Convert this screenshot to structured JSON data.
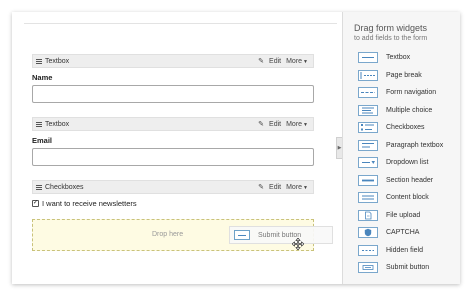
{
  "form": {
    "fields": [
      {
        "type": "Textbox",
        "label": "Name",
        "edit": "Edit",
        "more": "More"
      },
      {
        "type": "Textbox",
        "label": "Email",
        "edit": "Edit",
        "more": "More"
      },
      {
        "type": "Checkboxes",
        "edit": "Edit",
        "more": "More",
        "option": "I want to receive newsletters",
        "checked": true
      }
    ],
    "dropzone": {
      "label": "Drop here",
      "dragging": "Submit button"
    }
  },
  "panel": {
    "title": "Drag form widgets",
    "subtitle": "to add fields to the form",
    "widgets": [
      {
        "label": "Textbox",
        "icon": "textbox-icon"
      },
      {
        "label": "Page break",
        "icon": "page-break-icon"
      },
      {
        "label": "Form navigation",
        "icon": "form-navigation-icon"
      },
      {
        "label": "Multiple choice",
        "icon": "multiple-choice-icon"
      },
      {
        "label": "Checkboxes",
        "icon": "checkboxes-icon"
      },
      {
        "label": "Paragraph textbox",
        "icon": "paragraph-textbox-icon"
      },
      {
        "label": "Dropdown list",
        "icon": "dropdown-list-icon"
      },
      {
        "label": "Section header",
        "icon": "section-header-icon"
      },
      {
        "label": "Content block",
        "icon": "content-block-icon"
      },
      {
        "label": "File upload",
        "icon": "file-upload-icon"
      },
      {
        "label": "CAPTCHA",
        "icon": "captcha-icon"
      },
      {
        "label": "Hidden field",
        "icon": "hidden-field-icon"
      },
      {
        "label": "Submit button",
        "icon": "submit-button-icon"
      }
    ]
  },
  "colors": {
    "accent": "#4a86bd",
    "dropzone_bg": "#fefbe3",
    "panel_bg": "#f6f6f6"
  }
}
